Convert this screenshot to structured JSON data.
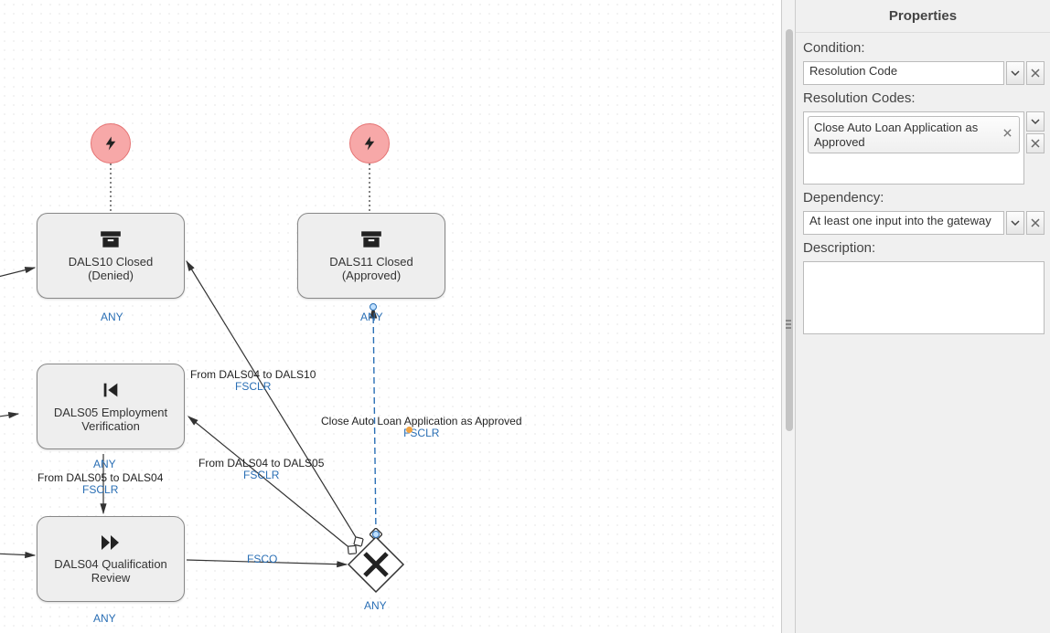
{
  "diagram": {
    "nodes": {
      "n1": {
        "line1": "DALS10 Closed",
        "line2": "(Denied)",
        "any": "ANY"
      },
      "n2": {
        "line1": "DALS11 Closed",
        "line2": "(Approved)",
        "any": "ANY"
      },
      "n3": {
        "line1": "DALS05 Employment",
        "line2": "Verification",
        "any": "ANY"
      },
      "n4": {
        "line1": "DALS04 Qualification",
        "line2": "Review",
        "any": "ANY"
      }
    },
    "gateway": {
      "any": "ANY"
    },
    "edges": {
      "e1": {
        "label": "From DALS04 to DALS10",
        "sub": "FSCLR"
      },
      "e2": {
        "label": "From DALS04 to DALS05",
        "sub": "FSCLR"
      },
      "e3": {
        "label": "Close Auto Loan Application as Approved",
        "sub": "FSCLR"
      },
      "e4": {
        "label": "From DALS05 to DALS04",
        "sub": "FSCLR"
      },
      "e5": {
        "sub": "FSCO"
      }
    }
  },
  "panel": {
    "title": "Properties",
    "condition_label": "Condition:",
    "condition_value": "Resolution Code",
    "resolution_codes_label": "Resolution Codes:",
    "resolution_tag": "Close Auto Loan Application as Approved",
    "dependency_label": "Dependency:",
    "dependency_value": "At least one input into the gateway",
    "description_label": "Description:"
  }
}
